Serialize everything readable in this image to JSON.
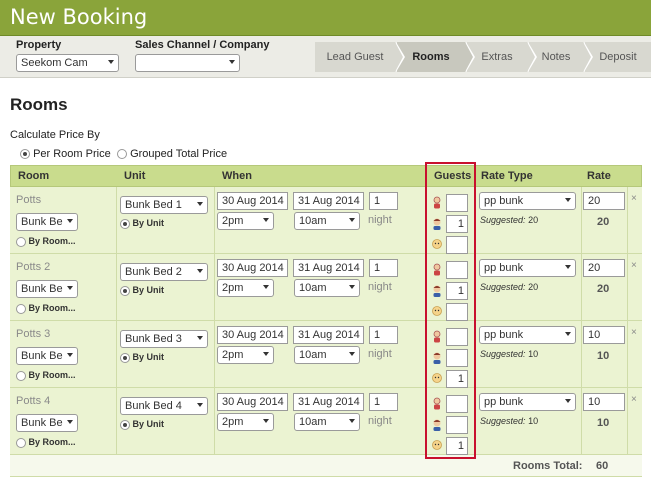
{
  "page": {
    "title": "New Booking"
  },
  "toolbar": {
    "property_label": "Property",
    "property_value": "Seekom Cam",
    "channel_label": "Sales Channel / Company",
    "channel_value": ""
  },
  "tabs": [
    "Lead Guest",
    "Rooms",
    "Extras",
    "Notes",
    "Deposit"
  ],
  "active_tab": "Rooms",
  "section_title": "Rooms",
  "calc": {
    "label": "Calculate Price By",
    "option_per_room": "Per Room Price",
    "option_grouped": "Grouped Total Price",
    "selected": "Per Room Price"
  },
  "table": {
    "headers": {
      "room": "Room",
      "unit": "Unit",
      "when": "When",
      "guests": "Guests",
      "rate_type": "Rate Type",
      "rate": "Rate"
    },
    "by_room_label": "By Room...",
    "by_unit_label": "By Unit",
    "night_label": "night",
    "suggested_label": "Suggested:",
    "remove_icon_glyph": "×",
    "rows": [
      {
        "room": "Potts",
        "room_select": "Bunk Be",
        "unit": "Bunk Bed 1",
        "from": "30 Aug 2014",
        "to": "31 Aug 2014",
        "nights": "1",
        "from_time": "2pm",
        "to_time": "10am",
        "guests": [
          "",
          "1",
          ""
        ],
        "rate_type": "pp bunk",
        "rate": "20",
        "suggested": "20",
        "rate_total": "20"
      },
      {
        "room": "Potts 2",
        "room_select": "Bunk Be",
        "unit": "Bunk Bed 2",
        "from": "30 Aug 2014",
        "to": "31 Aug 2014",
        "nights": "1",
        "from_time": "2pm",
        "to_time": "10am",
        "guests": [
          "",
          "1",
          ""
        ],
        "rate_type": "pp bunk",
        "rate": "20",
        "suggested": "20",
        "rate_total": "20"
      },
      {
        "room": "Potts 3",
        "room_select": "Bunk Be",
        "unit": "Bunk Bed 3",
        "from": "30 Aug 2014",
        "to": "31 Aug 2014",
        "nights": "1",
        "from_time": "2pm",
        "to_time": "10am",
        "guests": [
          "",
          "",
          "1"
        ],
        "rate_type": "pp bunk",
        "rate": "10",
        "suggested": "10",
        "rate_total": "10"
      },
      {
        "room": "Potts 4",
        "room_select": "Bunk Be",
        "unit": "Bunk Bed 4",
        "from": "30 Aug 2014",
        "to": "31 Aug 2014",
        "nights": "1",
        "from_time": "2pm",
        "to_time": "10am",
        "guests": [
          "",
          "",
          "1"
        ],
        "rate_type": "pp bunk",
        "rate": "10",
        "suggested": "10",
        "rate_total": "10"
      }
    ],
    "totals_label": "Rooms Total:",
    "totals_value": "60"
  },
  "colors": {
    "header_bar": "#8aa43a",
    "table_header": "#c9dc8d",
    "row_bg": "#ebf3d2",
    "highlight": "#c8102e"
  },
  "icons": [
    "adult-guest-icon",
    "child-guest-icon",
    "infant-guest-icon",
    "remove-icon",
    "dropdown-arrow-icon"
  ]
}
